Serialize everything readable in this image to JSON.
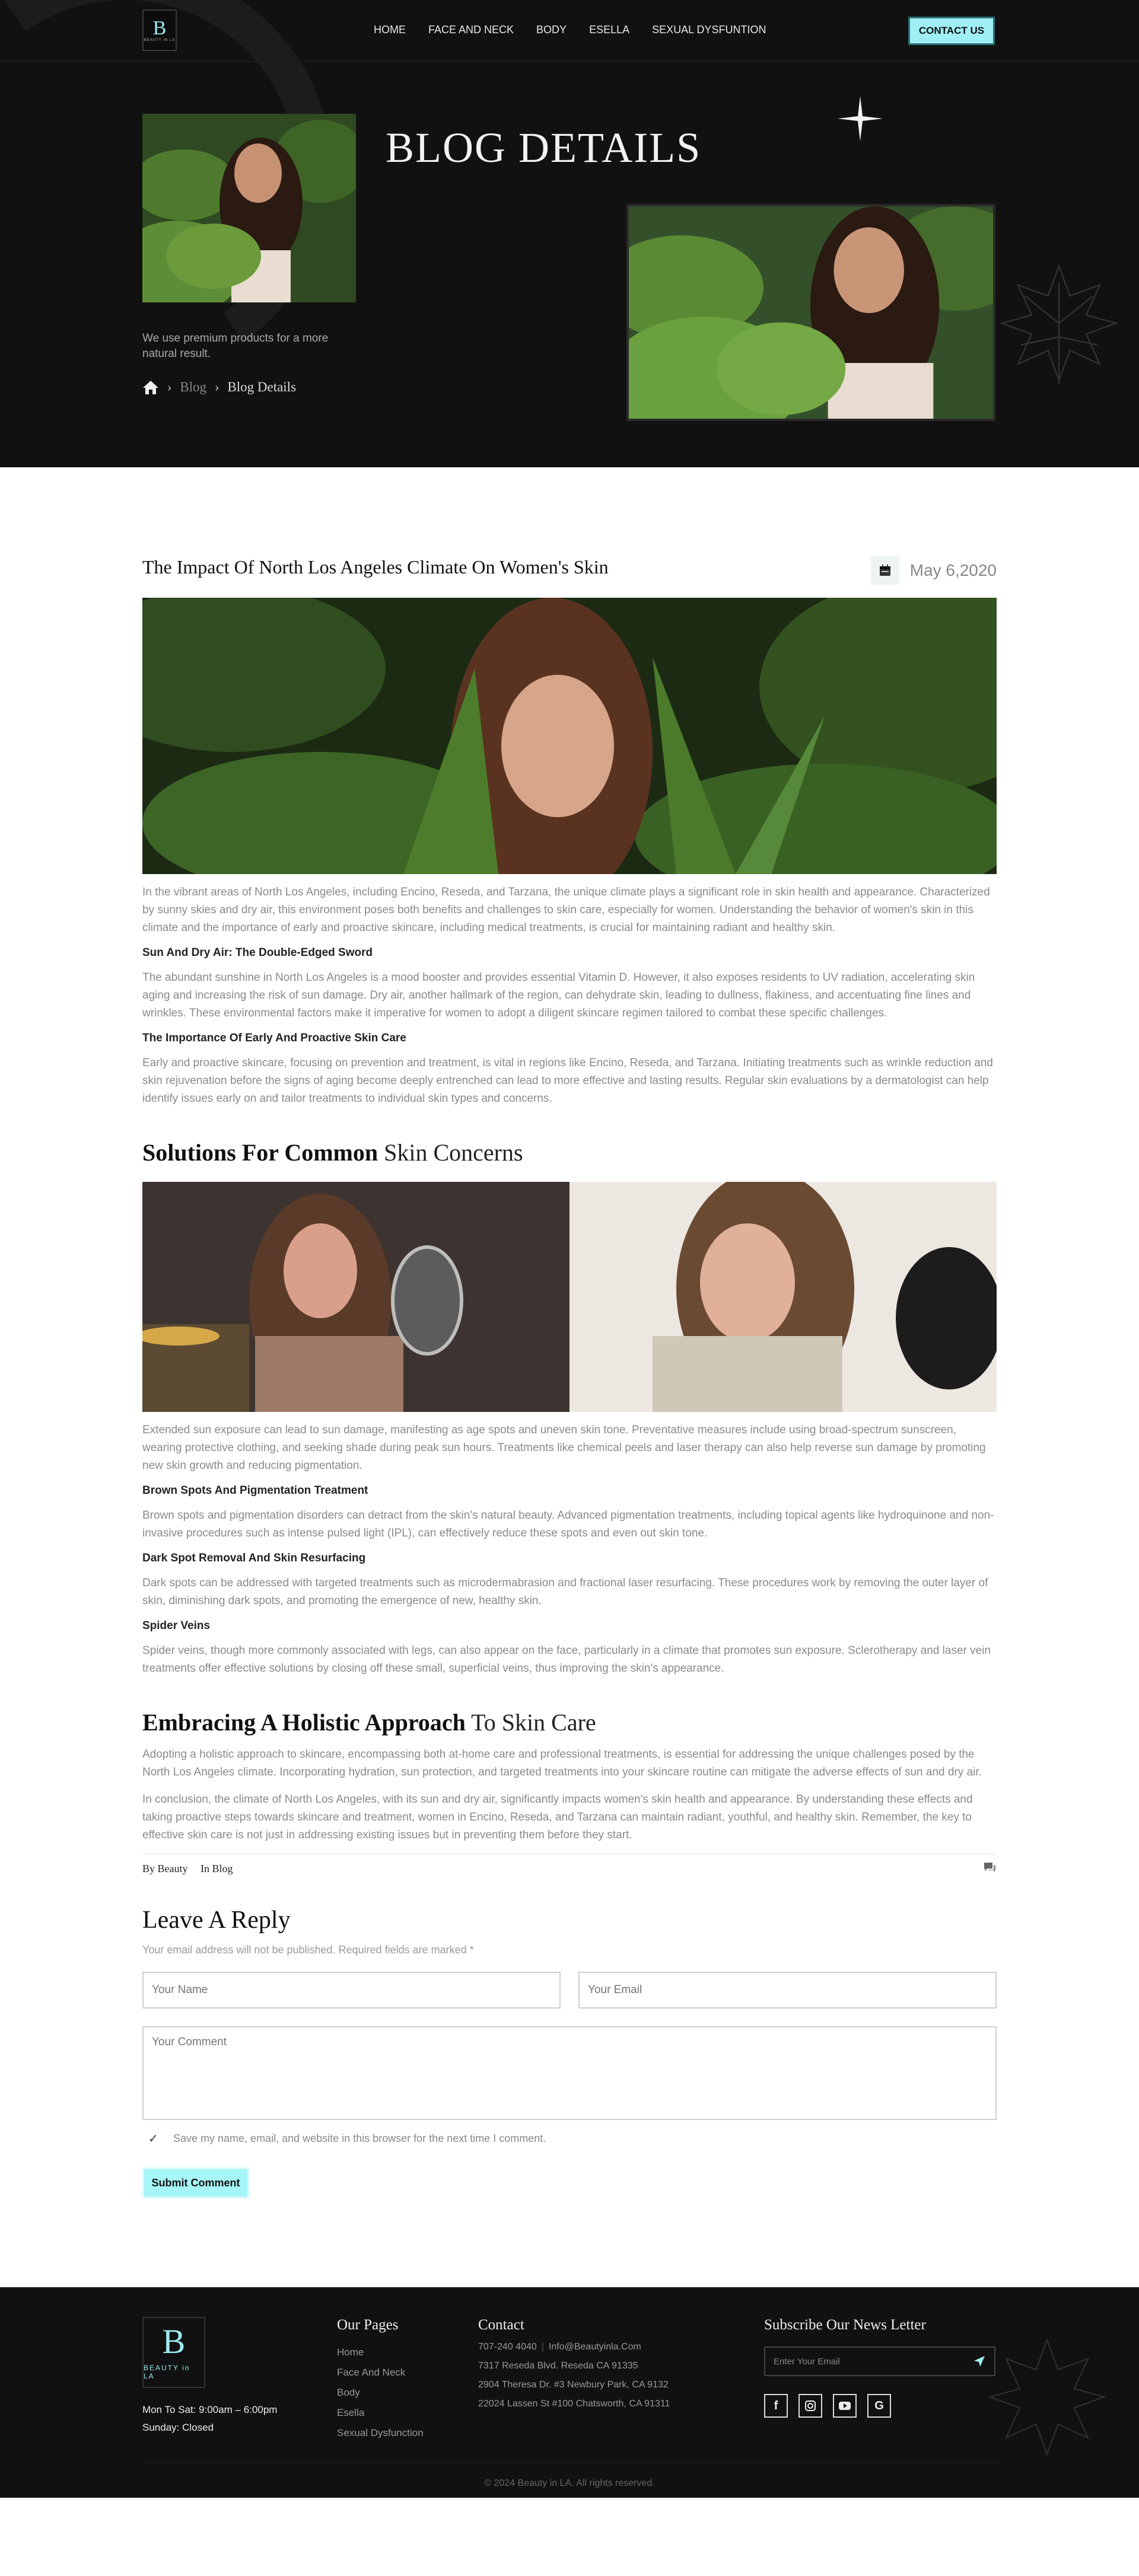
{
  "nav": {
    "logo_text": "BEAUTY IN LA",
    "links": [
      "HOME",
      "FACE AND NECK",
      "BODY",
      "ESELLA",
      "SEXUAL DYSFUNTION"
    ],
    "contact_label": "CONTACT US"
  },
  "hero": {
    "title": "BLOG DETAILS",
    "tagline": "We use premium products for a more natural result.",
    "crumb_blog": "Blog",
    "crumb_current": "Blog Details"
  },
  "post": {
    "title": "The Impact Of North Los Angeles Climate On Women's Skin",
    "date": "May 6,2020",
    "intro": "In the vibrant areas of North Los Angeles, including Encino, Reseda, and Tarzana, the unique climate plays a significant role in skin health and appearance. Characterized by sunny skies and dry air, this environment poses both benefits and challenges to skin care, especially for women. Understanding the behavior of women's skin in this climate and the importance of early and proactive skincare, including medical treatments, is crucial for maintaining radiant and healthy skin.",
    "h1": "Sun And Dry Air: The Double-Edged Sword",
    "p1": "The abundant sunshine in North Los Angeles is a mood booster and provides essential Vitamin D. However, it also exposes residents to UV radiation, accelerating skin aging and increasing the risk of sun damage. Dry air, another hallmark of the region, can dehydrate skin, leading to dullness, flakiness, and accentuating fine lines and wrinkles. These environmental factors make it imperative for women to adopt a diligent skincare regimen tailored to combat these specific challenges.",
    "h2": "The Importance Of Early And Proactive Skin Care",
    "p2": "Early and proactive skincare, focusing on prevention and treatment, is vital in regions like Encino, Reseda, and Tarzana. Initiating treatments such as wrinkle reduction and skin rejuvenation before the signs of aging become deeply entrenched can lead to more effective and lasting results. Regular skin evaluations by a dermatologist can help identify issues early on and tailor treatments to individual skin types and concerns.",
    "sec2_bold": "Solutions For Common",
    "sec2_light": " Skin Concerns",
    "p3": "Extended sun exposure can lead to sun damage, manifesting as age spots and uneven skin tone. Preventative measures include using broad-spectrum sunscreen, wearing protective clothing, and seeking shade during peak sun hours. Treatments like chemical peels and laser therapy can also help reverse sun damage by promoting new skin growth and reducing pigmentation.",
    "h3": "Brown Spots And Pigmentation Treatment",
    "p4": "Brown spots and pigmentation disorders can detract from the skin's natural beauty. Advanced pigmentation treatments, including topical agents like hydroquinone and non-invasive procedures such as intense pulsed light (IPL), can effectively reduce these spots and even out skin tone.",
    "h4": "Dark Spot Removal And Skin Resurfacing",
    "p5": "Dark spots can be addressed with targeted treatments such as microdermabrasion and fractional laser resurfacing. These procedures work by removing the outer layer of skin, diminishing dark spots, and promoting the emergence of new, healthy skin.",
    "h5": "Spider Veins",
    "p6": "Spider veins, though more commonly associated with legs, can also appear on the face, particularly in a climate that promotes sun exposure. Sclerotherapy and laser vein treatments offer effective solutions by closing off these small, superficial veins, thus improving the skin's appearance.",
    "sec3_bold": "Embracing A Holistic Approach",
    "sec3_light": " To Skin Care",
    "p7": "Adopting a holistic approach to skincare, encompassing both at-home care and professional treatments, is essential for addressing the unique challenges posed by the North Los Angeles climate. Incorporating hydration, sun protection, and targeted treatments into your skincare routine can mitigate the adverse effects of sun and dry air.",
    "p8": "In conclusion, the climate of North Los Angeles, with its sun and dry air, significantly impacts women's skin health and appearance. By understanding these effects and taking proactive steps towards skincare and treatment, women in Encino, Reseda, and Tarzana can maintain radiant, youthful, and healthy skin. Remember, the key to effective skin care is not just in addressing existing issues but in preventing them before they start.",
    "by": "By Beauty",
    "category": "In Blog"
  },
  "reply": {
    "title_bold": "Leave A",
    "title_light": " Reply",
    "note": "Your email address will not be published. Required fields are marked *",
    "name_placeholder": "Your Name",
    "email_placeholder": "Your Email",
    "comment_placeholder": "Your Comment",
    "save_label": "Save my name, email, and website in this browser for the next time I comment.",
    "submit_label": "Submit Comment"
  },
  "footer": {
    "logo_text": "BEAUTY in LA",
    "hours": "Mon To Sat: 9:00am – 6:00pm",
    "closed": "Sunday: Closed",
    "pages_title": "Our Pages",
    "pages": [
      "Home",
      "Face And  Neck",
      "Body",
      "Esella",
      "Sexual Dysfunction"
    ],
    "contact_title": "Contact",
    "phone": "707-240 4040",
    "email": "Info@Beautyinla.Com",
    "addr1": "7317 Reseda Blvd. Reseda CA 91335",
    "addr2": "2904 Theresa Dr. #3 Newbury Park, CA 9132",
    "addr3": "22024 Lassen St #100 Chatsworth, CA 91311",
    "sub_title": "Subscribe Our News Letter",
    "sub_placeholder": "Enter Your Email",
    "copyright": "© 2024 Beauty in LA. All rights reserved.",
    "social_icons": [
      "facebook-icon",
      "instagram-icon",
      "youtube-icon",
      "google-icon"
    ]
  },
  "colors": {
    "dark_bg": "#111111",
    "accent": "#9ff0f5"
  }
}
